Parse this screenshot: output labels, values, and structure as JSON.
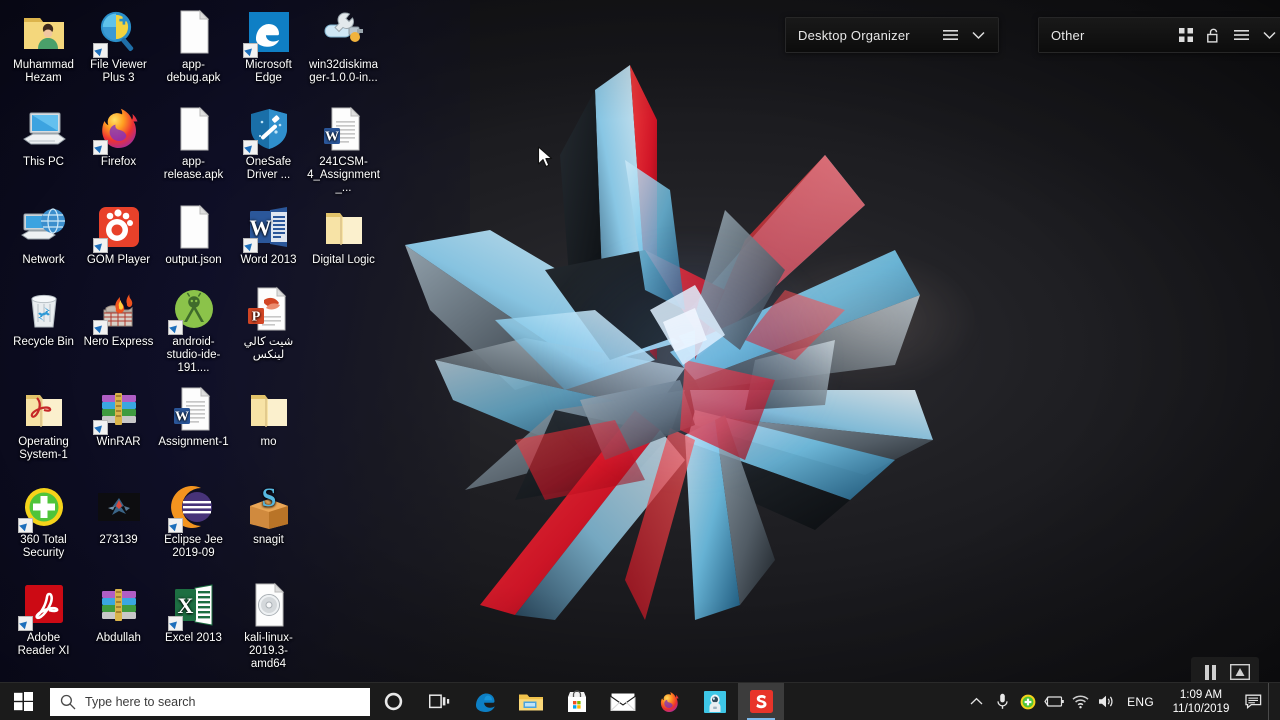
{
  "desktop": {
    "wallpaper_name": "abstract-3d-shattered-star-wallpaper",
    "colors": {
      "background_dark": "#19191d",
      "background_navy": "#0d0d24",
      "accent_red": "#e8192c",
      "accent_cyan": "#9fd8f2",
      "taskbar": "#1b1b1b"
    },
    "icons": [
      {
        "label": "Muhammad Hezam",
        "icon": "folder-user-icon",
        "shortcut": false,
        "col": 0,
        "row": 0
      },
      {
        "label": "File Viewer Plus 3",
        "icon": "file-viewer-plus-icon",
        "shortcut": true,
        "col": 1,
        "row": 0
      },
      {
        "label": "app-debug.apk",
        "icon": "blank-document-icon",
        "shortcut": false,
        "col": 2,
        "row": 0
      },
      {
        "label": "Microsoft Edge",
        "icon": "microsoft-edge-icon",
        "shortcut": true,
        "col": 3,
        "row": 0
      },
      {
        "label": "win32diskimager-1.0.0-in...",
        "icon": "win32diskimager-icon",
        "shortcut": false,
        "col": 4,
        "row": 0
      },
      {
        "label": "This PC",
        "icon": "this-pc-icon",
        "shortcut": false,
        "col": 0,
        "row": 1
      },
      {
        "label": "Firefox",
        "icon": "firefox-icon",
        "shortcut": true,
        "col": 1,
        "row": 1
      },
      {
        "label": "app-release.apk",
        "icon": "blank-document-icon",
        "shortcut": false,
        "col": 2,
        "row": 1
      },
      {
        "label": "OneSafe Driver ...",
        "icon": "onesafe-driver-icon",
        "shortcut": true,
        "col": 3,
        "row": 1
      },
      {
        "label": "241CSM-4_Assignment_...",
        "icon": "word-document-icon",
        "shortcut": false,
        "col": 4,
        "row": 1
      },
      {
        "label": "Network",
        "icon": "network-icon",
        "shortcut": false,
        "col": 0,
        "row": 2
      },
      {
        "label": "GOM Player",
        "icon": "gom-player-icon",
        "shortcut": true,
        "col": 1,
        "row": 2
      },
      {
        "label": "output.json",
        "icon": "blank-document-icon",
        "shortcut": false,
        "col": 2,
        "row": 2
      },
      {
        "label": "Word 2013",
        "icon": "word-2013-icon",
        "shortcut": true,
        "col": 3,
        "row": 2
      },
      {
        "label": "Digital Logic",
        "icon": "folder-open-icon",
        "shortcut": false,
        "col": 4,
        "row": 2
      },
      {
        "label": "Recycle Bin",
        "icon": "recycle-bin-icon",
        "shortcut": false,
        "col": 0,
        "row": 3
      },
      {
        "label": "Nero Express",
        "icon": "nero-express-icon",
        "shortcut": true,
        "col": 1,
        "row": 3
      },
      {
        "label": "android-studio-ide-191....",
        "icon": "android-studio-icon",
        "shortcut": true,
        "col": 2,
        "row": 3
      },
      {
        "label": "شيت كالي لينكس",
        "icon": "powerpoint-document-icon",
        "shortcut": false,
        "col": 3,
        "row": 3
      },
      {
        "label": "Operating System-1",
        "icon": "pdf-folder-icon",
        "shortcut": false,
        "col": 0,
        "row": 4
      },
      {
        "label": "WinRAR",
        "icon": "winrar-icon",
        "shortcut": true,
        "col": 1,
        "row": 4
      },
      {
        "label": "Assignment-1",
        "icon": "word-document-icon",
        "shortcut": false,
        "col": 2,
        "row": 4
      },
      {
        "label": "mo",
        "icon": "folder-open-icon",
        "shortcut": false,
        "col": 3,
        "row": 4
      },
      {
        "label": "360 Total Security",
        "icon": "360-total-security-icon",
        "shortcut": true,
        "col": 0,
        "row": 5
      },
      {
        "label": "273139",
        "icon": "image-thumbnail-icon",
        "shortcut": false,
        "col": 1,
        "row": 5
      },
      {
        "label": "Eclipse Jee 2019-09",
        "icon": "eclipse-icon",
        "shortcut": true,
        "col": 2,
        "row": 5
      },
      {
        "label": "snagit",
        "icon": "snagit-box-icon",
        "shortcut": false,
        "col": 3,
        "row": 5
      },
      {
        "label": "Adobe Reader XI",
        "icon": "adobe-reader-icon",
        "shortcut": true,
        "col": 0,
        "row": 6
      },
      {
        "label": "Abdullah",
        "icon": "winrar-icon",
        "shortcut": false,
        "col": 1,
        "row": 6
      },
      {
        "label": "Excel 2013",
        "icon": "excel-2013-icon",
        "shortcut": true,
        "col": 2,
        "row": 6
      },
      {
        "label": "kali-linux-2019.3-amd64",
        "icon": "disc-image-icon",
        "shortcut": false,
        "col": 3,
        "row": 6
      }
    ]
  },
  "fences": [
    {
      "title": "Desktop Organizer",
      "tools": [
        "hamburger-menu-icon",
        "chevron-down-icon"
      ]
    },
    {
      "title": "Other",
      "tools": [
        "grid-apps-icon",
        "unlock-padlock-icon",
        "hamburger-menu-icon",
        "chevron-down-icon"
      ]
    }
  ],
  "media_overlay": {
    "pause_label": "pause-icon",
    "screen_label": "fullscreen-icon"
  },
  "taskbar": {
    "start_label": "windows-start-icon",
    "search": {
      "placeholder": "Type here to search",
      "icon": "search-icon"
    },
    "buttons": [
      {
        "name": "cortana-button",
        "icon": "cortana-circle-icon",
        "label": "Cortana"
      },
      {
        "name": "task-view-button",
        "icon": "task-view-icon",
        "label": "Task View"
      }
    ],
    "pinned": [
      {
        "name": "taskbar-edge",
        "icon": "microsoft-edge-icon",
        "label": "Microsoft Edge",
        "active": false
      },
      {
        "name": "taskbar-file-explorer",
        "icon": "file-explorer-icon",
        "label": "File Explorer",
        "active": false
      },
      {
        "name": "taskbar-microsoft-store",
        "icon": "microsoft-store-icon",
        "label": "Microsoft Store",
        "active": false
      },
      {
        "name": "taskbar-mail",
        "icon": "mail-envelope-icon",
        "label": "Mail",
        "active": false
      },
      {
        "name": "taskbar-firefox",
        "icon": "firefox-icon",
        "label": "Firefox",
        "active": false
      },
      {
        "name": "taskbar-astronaut-app",
        "icon": "astronaut-app-icon",
        "label": "App",
        "active": false
      },
      {
        "name": "taskbar-snagit",
        "icon": "snagit-icon",
        "label": "Snagit",
        "active": true
      }
    ],
    "tray": {
      "overflow_icon": "chevron-up-icon",
      "items": [
        {
          "name": "microphone-icon",
          "label": "Microphone"
        },
        {
          "name": "360-total-security-tray-icon",
          "label": "360 Total Security"
        },
        {
          "name": "battery-icon",
          "label": "Battery"
        },
        {
          "name": "wifi-icon",
          "label": "Network"
        },
        {
          "name": "volume-icon",
          "label": "Volume"
        }
      ],
      "language": "ENG",
      "time": "1:09 AM",
      "date": "11/10/2019",
      "notification_icon": "action-center-icon"
    }
  }
}
